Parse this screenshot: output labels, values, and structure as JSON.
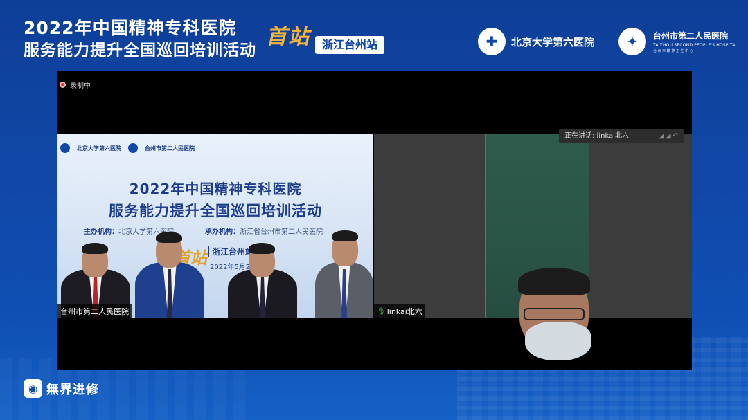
{
  "header": {
    "title_line1": "2022年中国精神专科医院",
    "title_line2": "服务能力提升全国巡回培训活动",
    "first_stop": "首站",
    "station": "浙江台州站",
    "logo1_text": "北京大学第六医院",
    "logo2_cn": "台州市第二人民医院",
    "logo2_en": "TAIZHOU SECOND PEOPLE'S HOSPITAL",
    "logo2_sub": "台 州 市 精 神 卫 生 中 心"
  },
  "meeting": {
    "recording_label": "录制中",
    "main_tile": {
      "logo1_text": "北京大学第六医院",
      "logo2_text": "台州市第二人民医院",
      "title1": "2022年中国精神专科医院",
      "title2": "服务能力提升全国巡回培训活动",
      "host_label": "主办机构：",
      "host_value": "北京大学第六医院",
      "organizer_label": "承办机构：",
      "organizer_value": "浙江省台州市第二人民医院",
      "first_stop": "首站",
      "station": "浙江台州站",
      "date": "2022年5月20日",
      "participant_label": "台州市第二人民医院"
    },
    "remote_tile": {
      "speaking_label": "正在讲话: linkai北六",
      "participant_label": "linkai北六"
    }
  },
  "footer": {
    "brand": "無界进修"
  },
  "colors": {
    "bg_blue": "#1148a8",
    "accent_gold": "#f2b43b",
    "rec_red": "#e5352b",
    "mic_green": "#3ec44b"
  }
}
